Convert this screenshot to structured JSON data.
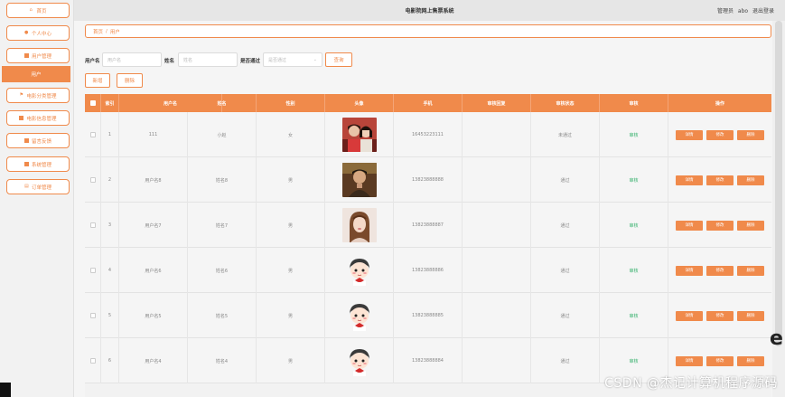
{
  "header": {
    "title": "电影院网上售票系统",
    "user_role": "管理员",
    "user_name": "abo",
    "logout": "退出登录"
  },
  "sidebar": {
    "items": [
      {
        "label": "首页",
        "icon": "home-icon"
      },
      {
        "label": "个人中心",
        "icon": "user-icon"
      },
      {
        "label": "用户管理",
        "icon": "grid-icon"
      },
      {
        "label": "用户",
        "icon": "",
        "active": true
      },
      {
        "label": "电影分类管理",
        "icon": "flag-icon"
      },
      {
        "label": "电影信息管理",
        "icon": "film-icon"
      },
      {
        "label": "留言反馈",
        "icon": "message-icon"
      },
      {
        "label": "系统管理",
        "icon": "grid-icon"
      },
      {
        "label": "订单管理",
        "icon": "order-icon"
      }
    ]
  },
  "breadcrumb": {
    "home": "首页",
    "separator": "/",
    "current": "用户"
  },
  "search": {
    "username_label": "用户名",
    "username_placeholder": "用户名",
    "name_label": "姓名",
    "name_placeholder": "姓名",
    "approved_label": "是否通过",
    "approved_placeholder": "是否通过",
    "query_button": "查询"
  },
  "toolbar": {
    "add_button": "新增",
    "delete_button": "删除"
  },
  "table": {
    "headers": [
      "索引",
      "用户名",
      "姓名",
      "性别",
      "头像",
      "手机",
      "审核回复",
      "审核状态",
      "审核",
      "操作"
    ],
    "rows": [
      {
        "index": "1",
        "username": "111",
        "name": "小赵",
        "gender": "女",
        "phone": "16453223111",
        "reply": "",
        "status": "未通过",
        "audit": "审核",
        "avatar": "photo-couple"
      },
      {
        "index": "2",
        "username": "用户名8",
        "name": "姓名8",
        "gender": "男",
        "phone": "13823888888",
        "reply": "",
        "status": "通过",
        "audit": "审核",
        "avatar": "photo-man"
      },
      {
        "index": "3",
        "username": "用户名7",
        "name": "姓名7",
        "gender": "男",
        "phone": "13823888887",
        "reply": "",
        "status": "通过",
        "audit": "审核",
        "avatar": "photo-woman"
      },
      {
        "index": "4",
        "username": "用户名6",
        "name": "姓名6",
        "gender": "男",
        "phone": "13823888886",
        "reply": "",
        "status": "通过",
        "audit": "审核",
        "avatar": "cartoon-boy"
      },
      {
        "index": "5",
        "username": "用户名5",
        "name": "姓名5",
        "gender": "男",
        "phone": "13823888885",
        "reply": "",
        "status": "通过",
        "audit": "审核",
        "avatar": "cartoon-boy"
      },
      {
        "index": "6",
        "username": "用户名4",
        "name": "姓名4",
        "gender": "男",
        "phone": "13823888884",
        "reply": "",
        "status": "通过",
        "audit": "审核",
        "avatar": "cartoon-boy"
      }
    ],
    "actions": {
      "detail": "详情",
      "edit": "修改",
      "delete": "删除"
    }
  },
  "watermark": "CSDN @杰记计算机程序源码",
  "side_char": "e",
  "colors": {
    "accent": "#f08a4b",
    "status_green": "#3cb371"
  }
}
